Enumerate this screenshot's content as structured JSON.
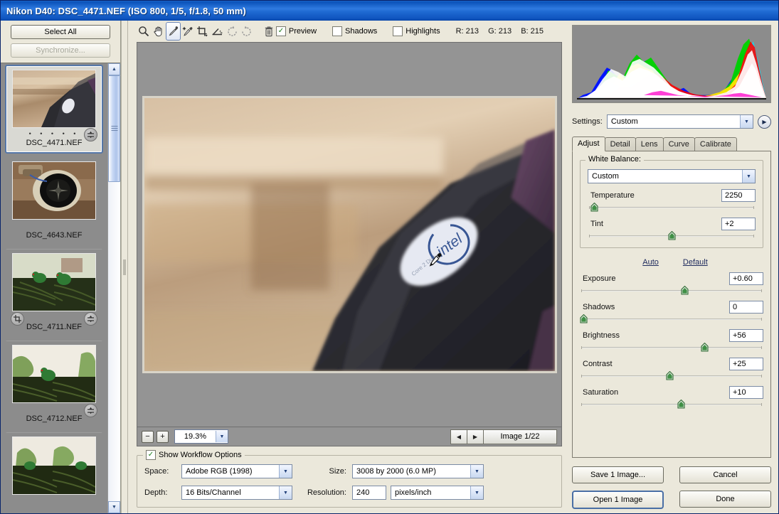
{
  "window": {
    "title": "Nikon D40:  DSC_4471.NEF  (ISO 800, 1/5, f/1.8, 50 mm)"
  },
  "filmstrip": {
    "select_all_label": "Select All",
    "synchronize_label": "Synchronize...",
    "thumbnails": [
      {
        "label": "DSC_4471.NEF",
        "rating": "•   •   •   •   •",
        "selected": true,
        "has_adjust_badge": true,
        "has_crop_badge": false
      },
      {
        "label": "DSC_4643.NEF",
        "rating": "",
        "selected": false,
        "has_adjust_badge": false,
        "has_crop_badge": false
      },
      {
        "label": "DSC_4711.NEF",
        "rating": "",
        "selected": false,
        "has_adjust_badge": true,
        "has_crop_badge": true
      },
      {
        "label": "DSC_4712.NEF",
        "rating": "",
        "selected": false,
        "has_adjust_badge": true,
        "has_crop_badge": false
      },
      {
        "label": "",
        "rating": "",
        "selected": false,
        "has_adjust_badge": false,
        "has_crop_badge": false
      }
    ]
  },
  "toolbar": {
    "tools": [
      {
        "name": "zoom-tool",
        "glyph": "zoom",
        "active": false
      },
      {
        "name": "hand-tool",
        "glyph": "hand",
        "active": false
      },
      {
        "name": "white-balance-eyedropper-tool",
        "glyph": "eyedropper",
        "active": true
      },
      {
        "name": "color-sampler-tool",
        "glyph": "color-sampler",
        "active": false
      },
      {
        "name": "crop-tool",
        "glyph": "crop",
        "active": false
      },
      {
        "name": "straighten-tool",
        "glyph": "straighten",
        "active": false
      },
      {
        "name": "rotate-counterclockwise-tool",
        "glyph": "rotate-ccw",
        "active": false
      },
      {
        "name": "rotate-clockwise-tool",
        "glyph": "rotate-cw",
        "active": false
      },
      {
        "name": "delete-tool",
        "glyph": "trash",
        "active": false
      }
    ],
    "preview_label": "Preview",
    "preview_checked": true,
    "shadows_label": "Shadows",
    "shadows_checked": false,
    "highlights_label": "Highlights",
    "highlights_checked": false,
    "readout": {
      "r": "R: 213",
      "g": "G: 213",
      "b": "B: 215"
    }
  },
  "zoombar": {
    "minus_label": "−",
    "plus_label": "+",
    "zoom_value": "19.3%",
    "prev_label": "◀",
    "next_label": "▶",
    "image_count": "Image 1/22"
  },
  "workflow": {
    "legend": "Show Workflow Options",
    "legend_checked": true,
    "space_label": "Space:",
    "space_value": "Adobe RGB (1998)",
    "depth_label": "Depth:",
    "depth_value": "16 Bits/Channel",
    "size_label": "Size:",
    "size_value": "3008 by 2000  (6.0 MP)",
    "resolution_label": "Resolution:",
    "resolution_value": "240",
    "resolution_unit": "pixels/inch"
  },
  "right": {
    "settings_label": "Settings:",
    "settings_value": "Custom",
    "tabs": [
      {
        "label": "Adjust",
        "active": true
      },
      {
        "label": "Detail",
        "active": false
      },
      {
        "label": "Lens",
        "active": false
      },
      {
        "label": "Curve",
        "active": false
      },
      {
        "label": "Calibrate",
        "active": false
      }
    ],
    "white_balance_legend": "White Balance:",
    "white_balance_value": "Custom",
    "auto_label": "Auto",
    "default_label": "Default",
    "sliders": [
      {
        "name": "Temperature",
        "value": "2250",
        "pos": 3
      },
      {
        "name": "Tint",
        "value": "+2",
        "pos": 50
      },
      {
        "name": "Exposure",
        "value": "+0.60",
        "pos": 57
      },
      {
        "name": "Shadows",
        "value": "0",
        "pos": 1
      },
      {
        "name": "Brightness",
        "value": "+56",
        "pos": 68
      },
      {
        "name": "Contrast",
        "value": "+25",
        "pos": 49
      },
      {
        "name": "Saturation",
        "value": "+10",
        "pos": 55
      }
    ],
    "buttons": [
      {
        "label": "Save 1 Image...",
        "default": false
      },
      {
        "label": "Cancel",
        "default": false
      },
      {
        "label": "Open 1 Image",
        "default": true
      },
      {
        "label": "Done",
        "default": false
      }
    ]
  },
  "colors": {
    "titlebar": "#1f6ad2",
    "panel_bg": "#ebe8db",
    "canvas_gray": "#949494",
    "filmstrip_bg": "#8c8c8c",
    "accent": "#4a6fa5",
    "slider_knob_green": "#3f8f45"
  }
}
